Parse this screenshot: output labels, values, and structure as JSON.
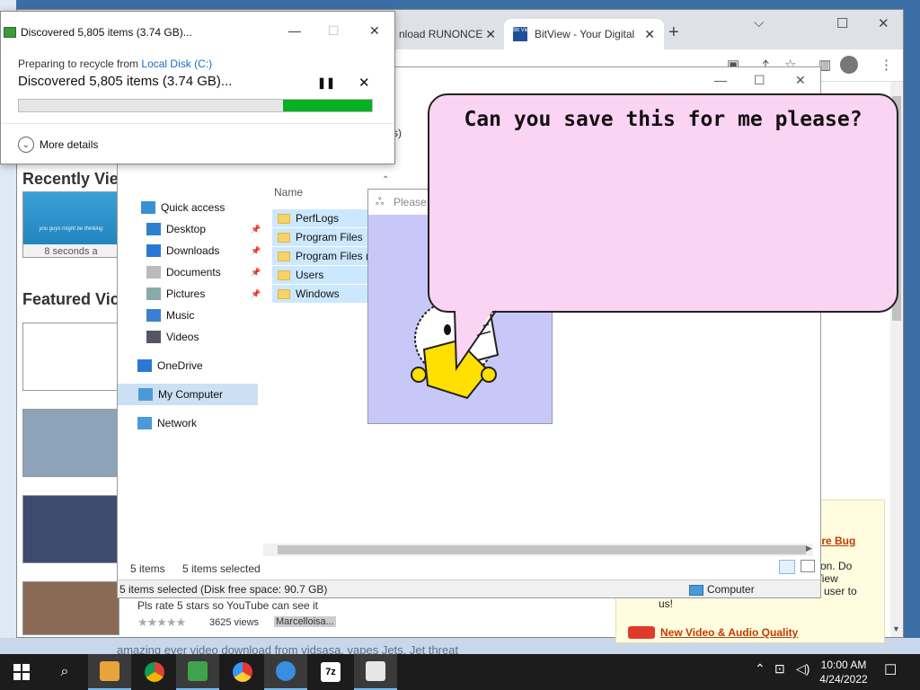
{
  "browser": {
    "tabs": [
      {
        "label": "nload RUNONCE"
      },
      {
        "label": "BitView - Your Digital",
        "favicon": "Bit View"
      }
    ],
    "new_tab": "+",
    "window_controls": [
      "⌵",
      "☐",
      "✕"
    ],
    "sections": {
      "recently_viewed": "Recently View",
      "featured": "Featured Vic"
    },
    "recent_video": {
      "caption": "you guys might be thinking",
      "ago": "8 seconds a"
    },
    "video": {
      "title": "Pls rate 5 stars so YouTube can see it",
      "stars": "★★★★★",
      "views": "3625 views",
      "uploader": "Marcelloisa..."
    },
    "sidebox": {
      "link1": "ore Bug",
      "text": "tion. Do\nView\ne user to",
      "text2": "us!",
      "link2": "New Video & Audio Quality"
    },
    "faded_desktop_text": "amazing ever video download from vidsasa, vapes Jets, Jet threat"
  },
  "explorer": {
    "title_controls": [
      "—",
      "☐",
      "✕"
    ],
    "breadcrumb": "s)",
    "nav": [
      {
        "label": "Quick access",
        "icon": "star-icon",
        "pinned": false
      },
      {
        "label": "Desktop",
        "icon": "desktop-icon",
        "pinned": true
      },
      {
        "label": "Downloads",
        "icon": "download-icon",
        "pinned": true
      },
      {
        "label": "Documents",
        "icon": "document-icon",
        "pinned": true
      },
      {
        "label": "Pictures",
        "icon": "picture-icon",
        "pinned": true
      },
      {
        "label": "Music",
        "icon": "music-icon",
        "pinned": false
      },
      {
        "label": "Videos",
        "icon": "video-icon",
        "pinned": false
      },
      {
        "label": "OneDrive",
        "icon": "cloud-icon",
        "pinned": false
      },
      {
        "label": "My Computer",
        "icon": "computer-icon",
        "pinned": false,
        "selected": true
      },
      {
        "label": "Network",
        "icon": "network-icon",
        "pinned": false
      }
    ],
    "column_header": "Name",
    "files": [
      "PerfLogs",
      "Program Files",
      "Program Files (x",
      "Users",
      "Windows"
    ],
    "status": {
      "count": "5 items",
      "selected": "5 items selected",
      "detail": "5 items selected (Disk free space: 90.7 GB)",
      "location": "Computer"
    }
  },
  "popup": {
    "title": "Please"
  },
  "bubble": {
    "text": "Can you save this for me please?"
  },
  "dialog": {
    "title": "Discovered 5,805 items (3.74 GB)...",
    "prep_prefix": "Preparing to recycle from ",
    "prep_link": "Local Disk (C:)",
    "main": "Discovered 5,805 items (3.74 GB)...",
    "pause": "❚❚",
    "close": "✕",
    "progress": 0.25,
    "more_details": "More details",
    "title_controls": [
      "—",
      "☐",
      "✕"
    ]
  },
  "taskbar": {
    "time": "10:00 AM",
    "date": "4/24/2022",
    "chip_colors": [
      "#e8a33b",
      "#e8e8e8",
      "#3fa34d",
      "#f0f0f0",
      "#3b8de0",
      "#ffffff",
      "#e6e6e6"
    ],
    "sevenzip_label": "7z"
  }
}
